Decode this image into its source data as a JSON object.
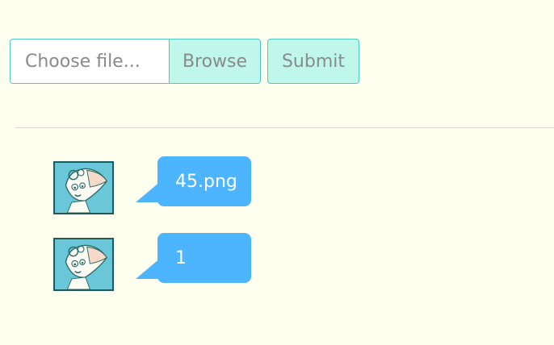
{
  "upload": {
    "file_placeholder": "Choose file...",
    "browse_label": "Browse",
    "submit_label": "Submit"
  },
  "messages": [
    {
      "text": "45.png",
      "avatar_icon": "character-avatar"
    },
    {
      "text": "1",
      "avatar_icon": "character-avatar"
    }
  ],
  "colors": {
    "background": "#fffff0",
    "accent_border": "#4ec9c0",
    "button_fill": "#bff7ea",
    "bubble": "#4db4ff",
    "avatar_bg": "#69c7d8"
  }
}
